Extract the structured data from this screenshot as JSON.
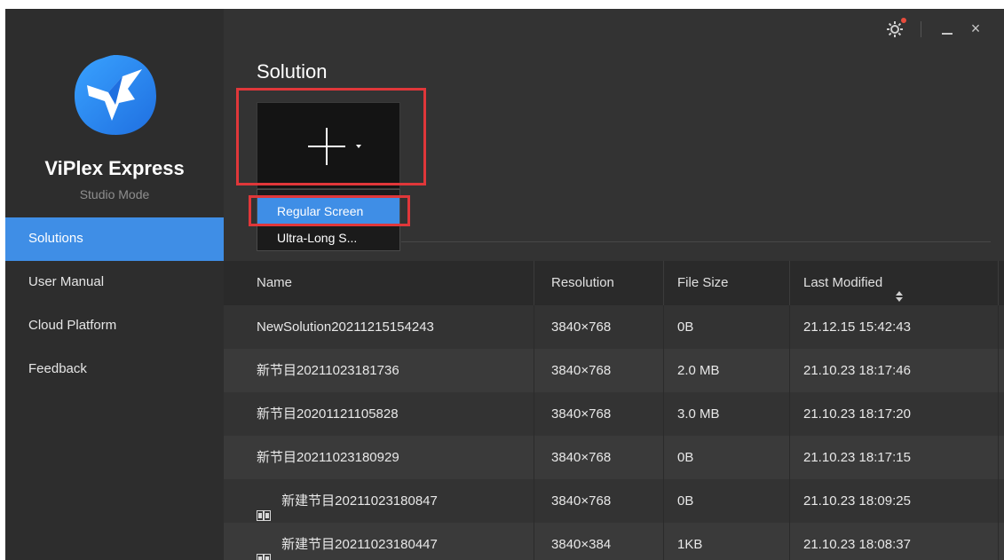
{
  "app": {
    "name": "ViPlex Express",
    "mode": "Studio Mode"
  },
  "sidebar": {
    "items": [
      {
        "label": "Solutions",
        "active": true
      },
      {
        "label": "User Manual",
        "active": false
      },
      {
        "label": "Cloud Platform",
        "active": false
      },
      {
        "label": "Feedback",
        "active": false
      }
    ]
  },
  "titlebar": {
    "icons": [
      "gear-icon",
      "minimize-icon",
      "close-icon"
    ],
    "close_glyph": "×"
  },
  "main": {
    "section_title": "Solution",
    "add_dropdown": {
      "options": [
        "Regular Screen",
        "Ultra-Long S..."
      ],
      "selected": "Regular Screen"
    }
  },
  "table": {
    "columns": [
      "Name",
      "Resolution",
      "File Size",
      "Last Modified"
    ],
    "rows": [
      {
        "name": "NewSolution20211215154243",
        "resolution": "3840×768",
        "size": "0B",
        "modified": "21.12.15 15:42:43",
        "icon": false
      },
      {
        "name": "新节目20211023181736",
        "resolution": "3840×768",
        "size": "2.0 MB",
        "modified": "21.10.23 18:17:46",
        "icon": false
      },
      {
        "name": "新节目20201121105828",
        "resolution": "3840×768",
        "size": "3.0 MB",
        "modified": "21.10.23 18:17:20",
        "icon": false
      },
      {
        "name": "新节目20211023180929",
        "resolution": "3840×768",
        "size": "0B",
        "modified": "21.10.23 18:17:15",
        "icon": false
      },
      {
        "name": "新建节目20211023180847",
        "resolution": "3840×768",
        "size": "0B",
        "modified": "21.10.23 18:09:25",
        "icon": true
      },
      {
        "name": "新建节目20211023180447",
        "resolution": "3840×384",
        "size": "1KB",
        "modified": "21.10.23 18:08:37",
        "icon": true
      }
    ]
  },
  "colors": {
    "accent": "#3f8ee6",
    "highlight": "#e0373a",
    "logo": "#2f8cf0"
  }
}
